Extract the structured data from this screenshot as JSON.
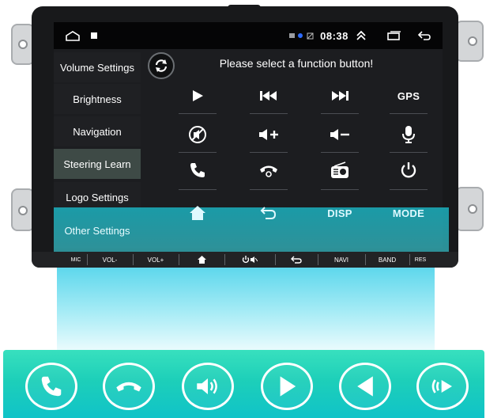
{
  "status_bar": {
    "home_icon": "home-outline-icon",
    "notification_icon": "square-notification-icon",
    "clock": "08:38",
    "status_icons": [
      "sim-card-icon",
      "bluetooth-icon",
      "no-sim-icon"
    ],
    "right_icons": [
      "double-chevron-up-icon",
      "recent-apps-icon",
      "back-arrow-icon"
    ]
  },
  "menu": {
    "items": [
      {
        "label": "Volume Settings"
      },
      {
        "label": "Brightness"
      },
      {
        "label": "Navigation"
      },
      {
        "label": "Steering Learn"
      },
      {
        "label": "Logo Settings"
      },
      {
        "label": "Other Settings"
      }
    ],
    "active": "Steering Learn"
  },
  "content": {
    "prompt": "Please select a function button!",
    "refresh_icon": "refresh-icon",
    "buttons": {
      "gps": "GPS",
      "disp": "DISP",
      "mode": "MODE"
    }
  },
  "hardware_buttons": {
    "mic": "MIC",
    "vol_down": "VOL-",
    "vol_up": "VOL+",
    "home_icon": "home-icon",
    "power_mute_icon": "power-mute-icon",
    "back_icon": "back-icon",
    "navi": "NAVI",
    "band": "BAND",
    "res": "RES"
  },
  "bottom_buttons": [
    "phone-icon",
    "hang-up-icon",
    "volume-icon",
    "play-icon",
    "previous-icon",
    "voice-icon"
  ],
  "colors": {
    "accent_teal": "#1dcfb9",
    "active_menu": "#3e4a46",
    "screen_bg": "#1c1d20"
  }
}
